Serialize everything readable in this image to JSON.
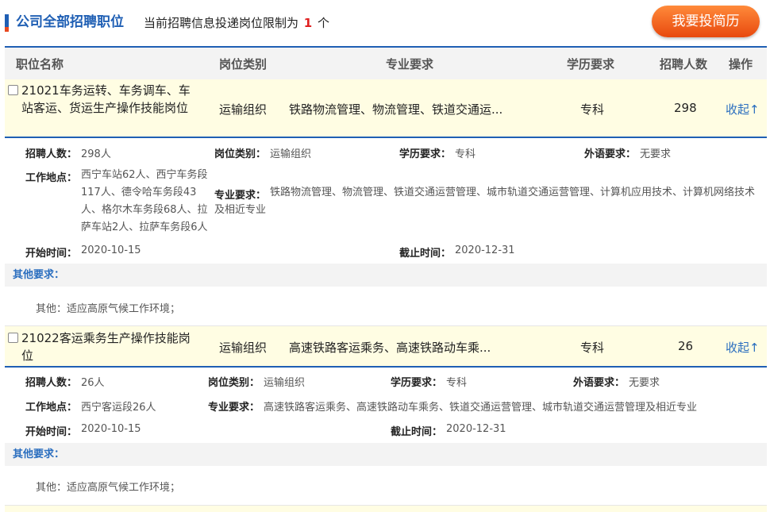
{
  "header": {
    "title": "公司全部招聘职位",
    "limit_prefix": "当前招聘信息投递岗位限制为",
    "limit_num": "1",
    "limit_suffix": "个",
    "apply_label": "我要投简历"
  },
  "columns": {
    "name": "职位名称",
    "category": "岗位类别",
    "major": "专业要求",
    "education": "学历要求",
    "count": "招聘人数",
    "action": "操作"
  },
  "labels": {
    "count": "招聘人数：",
    "category": "岗位类别：",
    "education": "学历要求：",
    "language": "外语要求：",
    "location": "工作地点：",
    "major": "专业要求：",
    "start": "开始时间：",
    "end": "截止时间：",
    "other": "其他要求："
  },
  "jobs": [
    {
      "name": "21021车务运转、车务调车、车站客运、货运生产操作技能岗位",
      "category": "运输组织",
      "major_short": "铁路物流管理、物流管理、铁道交通运...",
      "education": "专科",
      "count": "298",
      "toggle": "收起↑",
      "detail": {
        "count": "298人",
        "category": "运输组织",
        "education": "专科",
        "language": "无要求",
        "location": "西宁车站62人、西宁车务段117人、德令哈车务段43人、格尔木车务段68人、拉萨车站2人、拉萨车务段6人",
        "major": "铁路物流管理、物流管理、铁道交通运营管理、城市轨道交通运营管理、计算机应用技术、计算机网络技术及相近专业",
        "start": "2020-10-15",
        "end": "2020-12-31",
        "other": "其他：适应高原气候工作环境；"
      }
    },
    {
      "name": "21022客运乘务生产操作技能岗位",
      "category": "运输组织",
      "major_short": "高速铁路客运乘务、高速铁路动车乘...",
      "education": "专科",
      "count": "26",
      "toggle": "收起↑",
      "detail": {
        "count": "26人",
        "category": "运输组织",
        "education": "专科",
        "language": "无要求",
        "location": "西宁客运段26人",
        "major": "高速铁路客运乘务、高速铁路动车乘务、铁道交通运营管理、城市轨道交通运营管理及相近专业",
        "start": "2020-10-15",
        "end": "2020-12-31",
        "other": "其他：适应高原气候工作环境；"
      }
    }
  ]
}
